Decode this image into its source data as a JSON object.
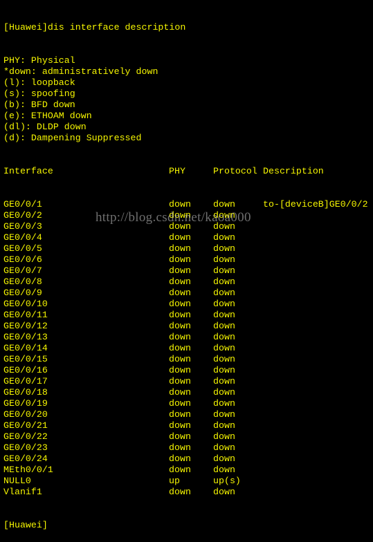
{
  "terminal": {
    "command_line": "[Huawei]dis interface description",
    "legend": [
      "PHY: Physical",
      "*down: administratively down",
      "(l): loopback",
      "(s): spoofing",
      "(b): BFD down",
      "(e): ETHOAM down",
      "(dl): DLDP down",
      "(d): Dampening Suppressed"
    ],
    "table": {
      "headers": {
        "interface": "Interface",
        "phy": "PHY",
        "protocol": "Protocol",
        "description": "Description"
      },
      "rows": [
        {
          "interface": "GE0/0/1",
          "phy": "down",
          "protocol": "down",
          "description": "to-[deviceB]GE0/0/2"
        },
        {
          "interface": "GE0/0/2",
          "phy": "down",
          "protocol": "down",
          "description": ""
        },
        {
          "interface": "GE0/0/3",
          "phy": "down",
          "protocol": "down",
          "description": ""
        },
        {
          "interface": "GE0/0/4",
          "phy": "down",
          "protocol": "down",
          "description": ""
        },
        {
          "interface": "GE0/0/5",
          "phy": "down",
          "protocol": "down",
          "description": ""
        },
        {
          "interface": "GE0/0/6",
          "phy": "down",
          "protocol": "down",
          "description": ""
        },
        {
          "interface": "GE0/0/7",
          "phy": "down",
          "protocol": "down",
          "description": ""
        },
        {
          "interface": "GE0/0/8",
          "phy": "down",
          "protocol": "down",
          "description": ""
        },
        {
          "interface": "GE0/0/9",
          "phy": "down",
          "protocol": "down",
          "description": ""
        },
        {
          "interface": "GE0/0/10",
          "phy": "down",
          "protocol": "down",
          "description": ""
        },
        {
          "interface": "GE0/0/11",
          "phy": "down",
          "protocol": "down",
          "description": ""
        },
        {
          "interface": "GE0/0/12",
          "phy": "down",
          "protocol": "down",
          "description": ""
        },
        {
          "interface": "GE0/0/13",
          "phy": "down",
          "protocol": "down",
          "description": ""
        },
        {
          "interface": "GE0/0/14",
          "phy": "down",
          "protocol": "down",
          "description": ""
        },
        {
          "interface": "GE0/0/15",
          "phy": "down",
          "protocol": "down",
          "description": ""
        },
        {
          "interface": "GE0/0/16",
          "phy": "down",
          "protocol": "down",
          "description": ""
        },
        {
          "interface": "GE0/0/17",
          "phy": "down",
          "protocol": "down",
          "description": ""
        },
        {
          "interface": "GE0/0/18",
          "phy": "down",
          "protocol": "down",
          "description": ""
        },
        {
          "interface": "GE0/0/19",
          "phy": "down",
          "protocol": "down",
          "description": ""
        },
        {
          "interface": "GE0/0/20",
          "phy": "down",
          "protocol": "down",
          "description": ""
        },
        {
          "interface": "GE0/0/21",
          "phy": "down",
          "protocol": "down",
          "description": ""
        },
        {
          "interface": "GE0/0/22",
          "phy": "down",
          "protocol": "down",
          "description": ""
        },
        {
          "interface": "GE0/0/23",
          "phy": "down",
          "protocol": "down",
          "description": ""
        },
        {
          "interface": "GE0/0/24",
          "phy": "down",
          "protocol": "down",
          "description": ""
        },
        {
          "interface": "MEth0/0/1",
          "phy": "down",
          "protocol": "down",
          "description": ""
        },
        {
          "interface": "NULL0",
          "phy": "up",
          "protocol": "up(s)",
          "description": ""
        },
        {
          "interface": "Vlanif1",
          "phy": "down",
          "protocol": "down",
          "description": ""
        }
      ]
    },
    "prompt": "[Huawei]"
  },
  "watermark": "http://blog.csdn.net/kaoa000",
  "colors": {
    "text": "#f5f500",
    "background": "#000000"
  }
}
